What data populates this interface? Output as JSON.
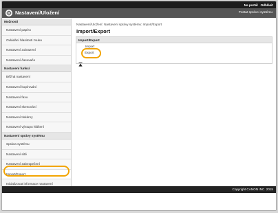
{
  "topbar": {
    "portal_link": "Na portál",
    "logout_link": "Odhlásit"
  },
  "header": {
    "title": "Nastavení/Uložení",
    "admin_mode": "Postat správci systému"
  },
  "sidebar": {
    "sections": [
      {
        "heading": "Možnosti",
        "items": [
          "Nastavení papíru",
          "Ovládání hlasitosti zvuku",
          "Nastavení zobrazení",
          "Nastavení časovače"
        ]
      },
      {
        "heading": "Nastavení funkcí",
        "items": [
          "Běžná nastavení",
          "Nastavení kopírování",
          "Nastavení faxu",
          "Nastavení skenování",
          "Nastavení tiskárny",
          "Nastavení výstupu hlášení"
        ]
      },
      {
        "heading": "Nastavení správy systému",
        "items": [
          "Správa systému",
          "Nastavení sítě",
          "Nastavení zabezpečení",
          "Import/Export",
          "Inicializovat informace nastavení"
        ]
      }
    ]
  },
  "main": {
    "breadcrumb": "Nastavení/Uložení: Nastavení správy systému: Import/Export",
    "title": "Import/Export",
    "panel_heading": "Import/Export",
    "import_link": "Import",
    "export_link": "Export"
  },
  "footer": {
    "copyright": "Copyright CANON INC. 2015"
  },
  "colors": {
    "highlight": "#f2a400",
    "topbar": "#1c1c1c",
    "titlebar": "#555555"
  },
  "icons": {
    "logo": "gear-settings-icon",
    "back_to_top": "back-to-top-icon"
  }
}
